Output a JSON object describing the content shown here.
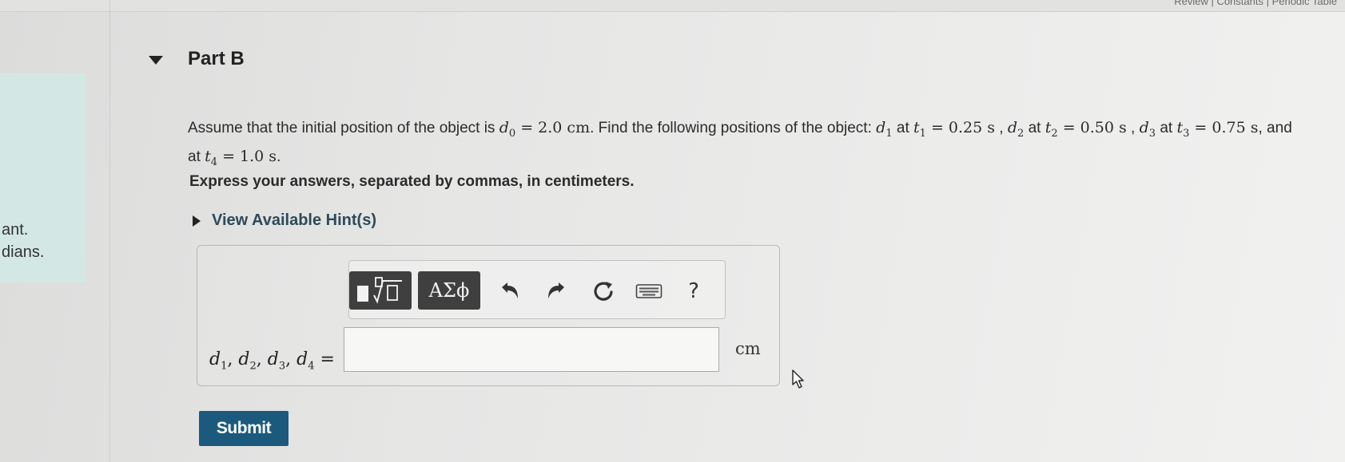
{
  "header": {
    "top_links": "Review | Constants | Periodic Table"
  },
  "left_panel": {
    "line1": "ant.",
    "line2": "dians."
  },
  "part": {
    "title": "Part B"
  },
  "problem": {
    "t1": "Assume that the initial position of the object is ",
    "d0_value": "2.0 cm",
    "t2": ". Find the following positions of the object: ",
    "t1_value": "0.25 s",
    "t2_value": "0.50 s",
    "t3_value": "0.75 s",
    "t4_value": "1.0 s",
    "at": " at ",
    "and": ", and",
    "comma": " , ",
    "end": "."
  },
  "instructions": "Express your answers, separated by commas, in centimeters.",
  "hint": {
    "label": "View Available Hint(s)"
  },
  "toolbar": {
    "templates_icon": "template-sqrt-icon",
    "greek_label": "ΑΣϕ",
    "undo_icon": "undo-icon",
    "redo_icon": "redo-icon",
    "reset_icon": "reset-icon",
    "keyboard_icon": "keyboard-icon",
    "help_label": "?"
  },
  "answer": {
    "label": "d1, d2, d3, d4 =",
    "value": "",
    "unit": "cm"
  },
  "submit": {
    "label": "Submit"
  },
  "colors": {
    "submit_bg": "#1b5a7c",
    "toolbar_btn": "#3f3f40",
    "hint_link": "#2d4a5a",
    "left_panel": "#d3e8e4"
  }
}
